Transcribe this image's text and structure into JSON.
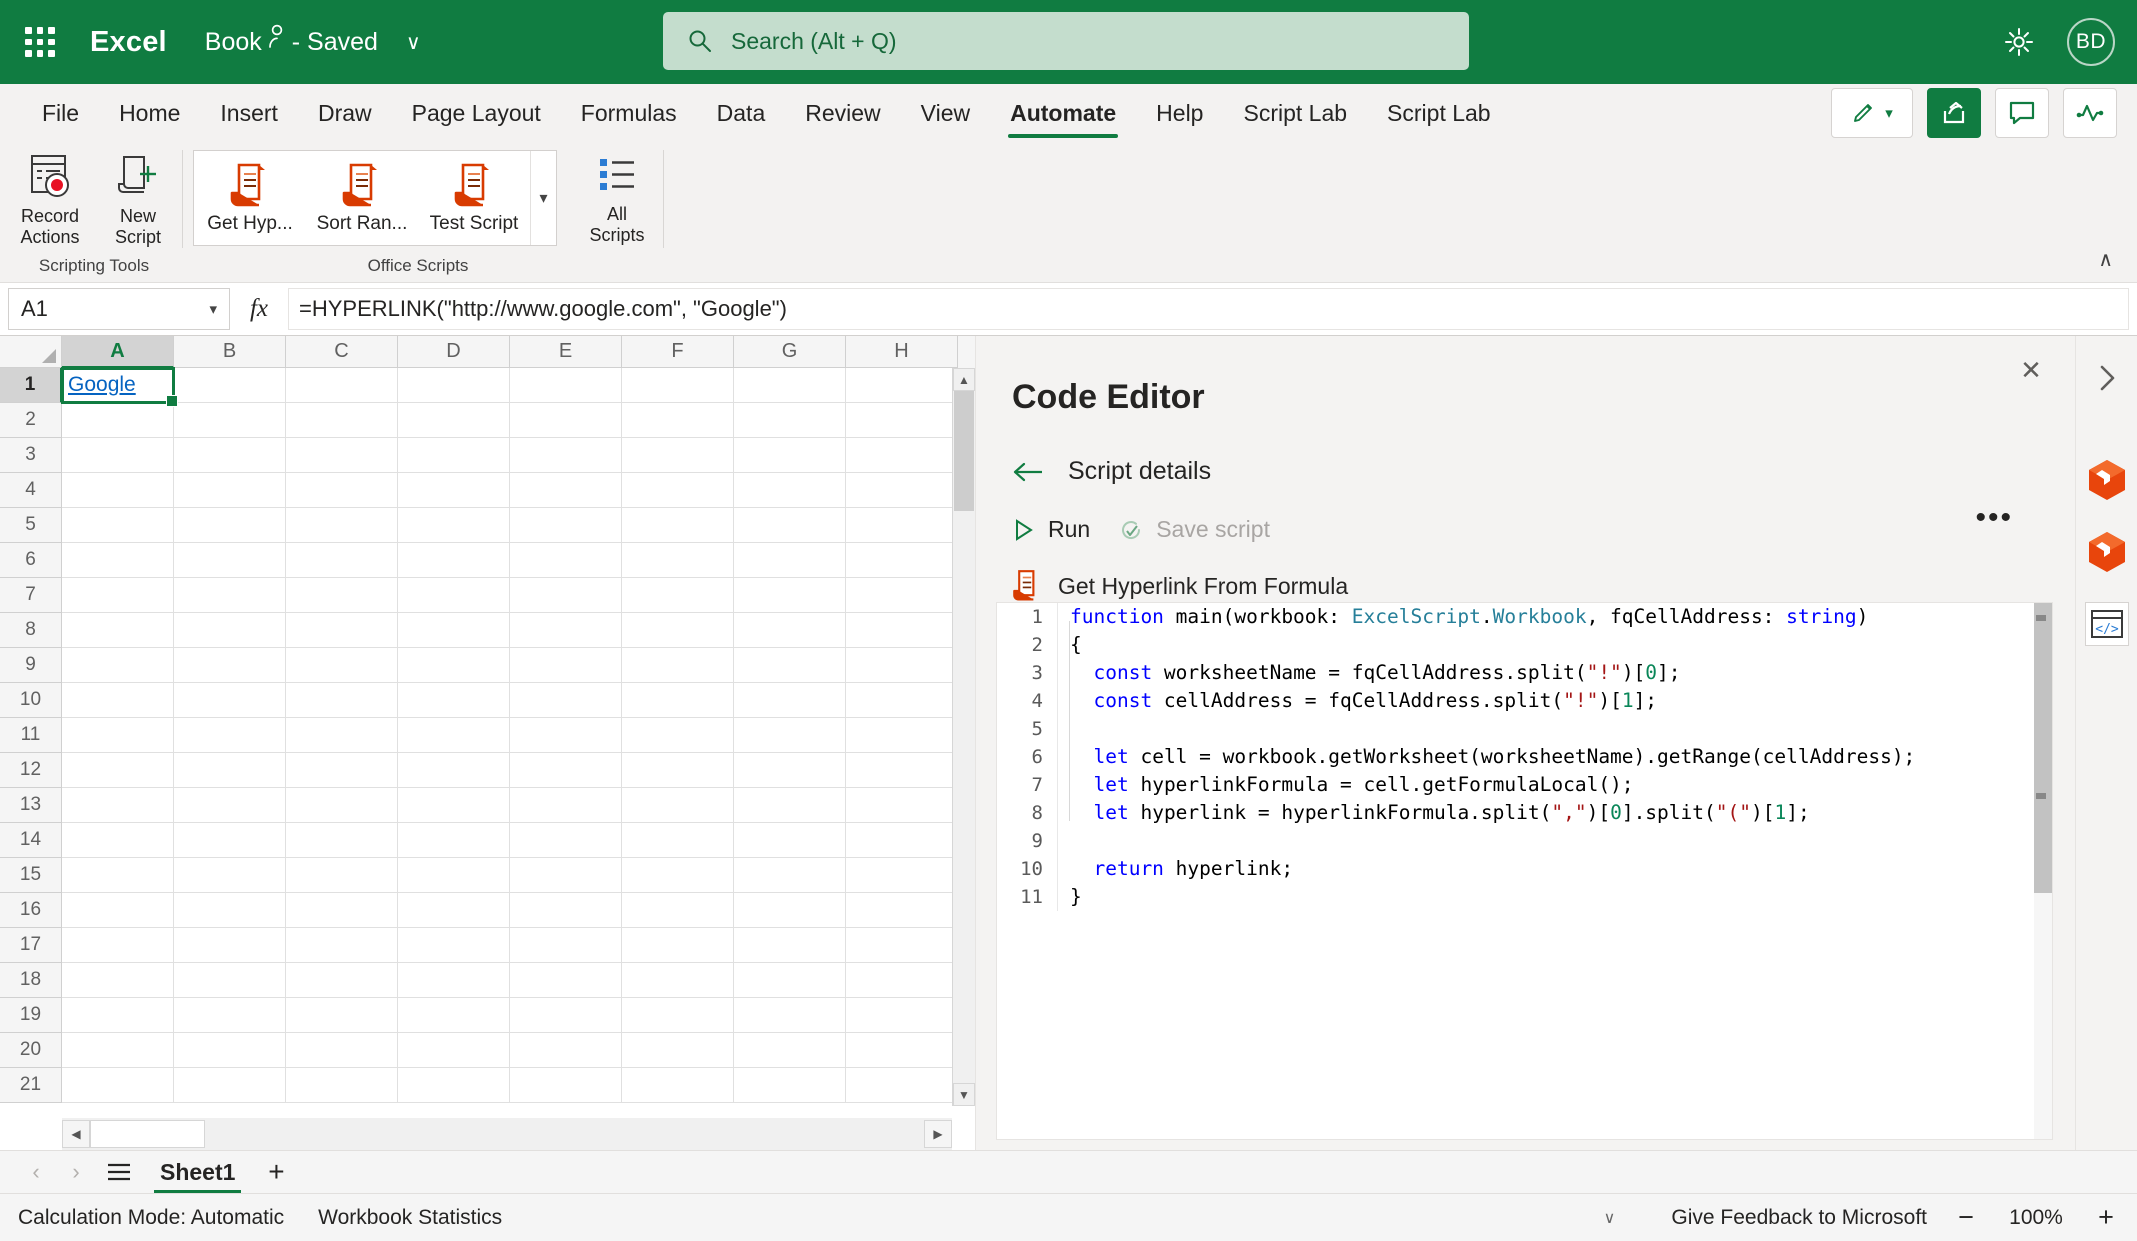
{
  "titlebar": {
    "app_name": "Excel",
    "doc_name": "Book",
    "doc_status": "- Saved",
    "chevron": "∨",
    "search_placeholder": "Search (Alt + Q)",
    "avatar_initials": "BD",
    "icons": [
      "app-launcher-icon",
      "gear-icon"
    ]
  },
  "ribbon": {
    "tabs": [
      {
        "label": "File",
        "active": false
      },
      {
        "label": "Home",
        "active": false
      },
      {
        "label": "Insert",
        "active": false
      },
      {
        "label": "Draw",
        "active": false
      },
      {
        "label": "Page Layout",
        "active": false
      },
      {
        "label": "Formulas",
        "active": false
      },
      {
        "label": "Data",
        "active": false
      },
      {
        "label": "Review",
        "active": false
      },
      {
        "label": "View",
        "active": false
      },
      {
        "label": "Automate",
        "active": true
      },
      {
        "label": "Help",
        "active": false
      },
      {
        "label": "Script Lab",
        "active": false
      },
      {
        "label": "Script Lab",
        "active": false
      }
    ],
    "right_buttons": [
      "editing-pencil-button",
      "share-button",
      "comments-button",
      "activity-button"
    ],
    "groups": [
      {
        "label": "Scripting Tools",
        "buttons": [
          {
            "label": "Record\nActions",
            "line1": "Record",
            "line2": "Actions"
          },
          {
            "label": "New\nScript",
            "line1": "New",
            "line2": "Script"
          }
        ]
      },
      {
        "label": "Office Scripts",
        "gallery": [
          {
            "label": "Get Hyp..."
          },
          {
            "label": "Sort Ran..."
          },
          {
            "label": "Test Script"
          }
        ],
        "all_scripts": {
          "line1": "All",
          "line2": "Scripts"
        }
      }
    ],
    "collapse_label": "∧"
  },
  "formula_bar": {
    "name_box_value": "A1",
    "fx_label": "fx",
    "formula": "=HYPERLINK(\"http://www.google.com\", \"Google\")"
  },
  "grid": {
    "columns": [
      "A",
      "B",
      "C",
      "D",
      "E",
      "F",
      "G",
      "H"
    ],
    "selected_column": "A",
    "rows": [
      "1",
      "2",
      "3",
      "4",
      "5",
      "6",
      "7",
      "8",
      "9",
      "10",
      "11",
      "12",
      "13",
      "14",
      "15",
      "16",
      "17",
      "18",
      "19",
      "20",
      "21"
    ],
    "selected_row": "1",
    "active_cell": "A1",
    "a1_value": "Google"
  },
  "panel": {
    "title": "Code Editor",
    "close_label": "✕",
    "back_label": "Script details",
    "run_label": "Run",
    "save_label": "Save script",
    "more_label": "•••",
    "script_name": "Get Hyperlink From Formula",
    "code_lines": [
      {
        "n": "1",
        "tokens": [
          {
            "t": "k",
            "v": "function"
          },
          {
            "t": "p",
            "v": " main(workbook: "
          },
          {
            "t": "t",
            "v": "ExcelScript"
          },
          {
            "t": "p",
            "v": "."
          },
          {
            "t": "t",
            "v": "Workbook"
          },
          {
            "t": "p",
            "v": ", fqCellAddress: "
          },
          {
            "t": "k",
            "v": "string"
          },
          {
            "t": "p",
            "v": ")"
          }
        ]
      },
      {
        "n": "2",
        "tokens": [
          {
            "t": "p",
            "v": "{"
          }
        ]
      },
      {
        "n": "3",
        "tokens": [
          {
            "t": "p",
            "v": "  "
          },
          {
            "t": "k",
            "v": "const"
          },
          {
            "t": "p",
            "v": " worksheetName = fqCellAddress.split("
          },
          {
            "t": "s",
            "v": "\"!\""
          },
          {
            "t": "p",
            "v": ")["
          },
          {
            "t": "n",
            "v": "0"
          },
          {
            "t": "p",
            "v": "];"
          }
        ]
      },
      {
        "n": "4",
        "tokens": [
          {
            "t": "p",
            "v": "  "
          },
          {
            "t": "k",
            "v": "const"
          },
          {
            "t": "p",
            "v": " cellAddress = fqCellAddress.split("
          },
          {
            "t": "s",
            "v": "\"!\""
          },
          {
            "t": "p",
            "v": ")["
          },
          {
            "t": "n",
            "v": "1"
          },
          {
            "t": "p",
            "v": "];"
          }
        ]
      },
      {
        "n": "5",
        "tokens": []
      },
      {
        "n": "6",
        "tokens": [
          {
            "t": "p",
            "v": "  "
          },
          {
            "t": "k",
            "v": "let"
          },
          {
            "t": "p",
            "v": " cell = workbook.getWorksheet(worksheetName).getRange(cellAddress);"
          }
        ]
      },
      {
        "n": "7",
        "tokens": [
          {
            "t": "p",
            "v": "  "
          },
          {
            "t": "k",
            "v": "let"
          },
          {
            "t": "p",
            "v": " hyperlinkFormula = cell.getFormulaLocal();"
          }
        ]
      },
      {
        "n": "8",
        "tokens": [
          {
            "t": "p",
            "v": "  "
          },
          {
            "t": "k",
            "v": "let"
          },
          {
            "t": "p",
            "v": " hyperlink = hyperlinkFormula.split("
          },
          {
            "t": "s",
            "v": "\",\""
          },
          {
            "t": "p",
            "v": ")["
          },
          {
            "t": "n",
            "v": "0"
          },
          {
            "t": "p",
            "v": "].split("
          },
          {
            "t": "s",
            "v": "\"(\""
          },
          {
            "t": "p",
            "v": ")["
          },
          {
            "t": "n",
            "v": "1"
          },
          {
            "t": "p",
            "v": "];"
          }
        ]
      },
      {
        "n": "9",
        "tokens": []
      },
      {
        "n": "10",
        "tokens": [
          {
            "t": "p",
            "v": "  "
          },
          {
            "t": "k",
            "v": "return"
          },
          {
            "t": "p",
            "v": " hyperlink;"
          }
        ]
      },
      {
        "n": "11",
        "tokens": [
          {
            "t": "p",
            "v": "}"
          }
        ]
      }
    ]
  },
  "rail": {
    "icons": [
      "chevron-right-icon",
      "script-lab-icon",
      "script-lab-icon",
      "code-editor-icon"
    ]
  },
  "sheetbar": {
    "prev_label": "‹",
    "next_label": "›",
    "menu_label": "all-sheets-icon",
    "tabs": [
      {
        "label": "Sheet1",
        "active": true
      }
    ],
    "add_label": "+"
  },
  "statusbar": {
    "items": [
      "Calculation Mode: Automatic",
      "Workbook Statistics"
    ],
    "feedback": "Give Feedback to Microsoft",
    "zoom_out": "−",
    "zoom_value": "100%",
    "zoom_in": "+",
    "chevron": "∨"
  },
  "colors": {
    "brand_green": "#107c41",
    "script_orange": "#d83b01",
    "link_blue": "#0563c1",
    "ribbon_bg": "#f3f2f1"
  }
}
